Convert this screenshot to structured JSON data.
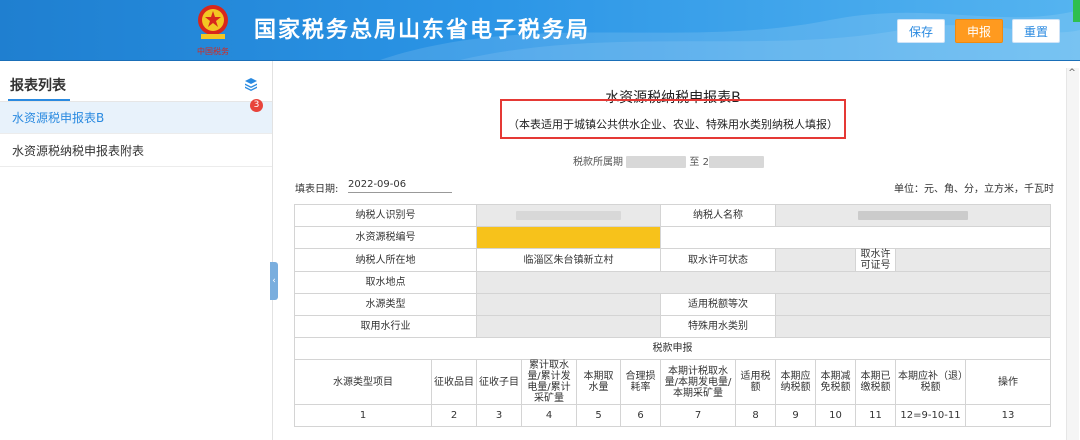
{
  "header": {
    "site_title": "国家税务总局山东省电子税务局",
    "logo_text": "中国税务",
    "buttons": {
      "save": "保存",
      "submit": "申报",
      "reset": "重置"
    }
  },
  "sidebar": {
    "title": "报表列表",
    "items": [
      {
        "label": "水资源税申报表B",
        "badge": "3",
        "active": true
      },
      {
        "label": "水资源税纳税申报表附表",
        "active": false
      }
    ]
  },
  "form": {
    "title": "水资源税纳税申报表B",
    "subtitle": "（本表适用于城镇公共供水企业、农业、特殊用水类别纳税人填报）",
    "period_label": "税款所属期",
    "period_to": "至",
    "period_to_prefix": "2",
    "fill_date_label": "填表日期:",
    "fill_date": "2022-09-06",
    "unit": "单位：元、角、分，立方米，千瓦时",
    "fields": {
      "taxpayer_id": "纳税人识别号",
      "taxpayer_name": "纳税人名称",
      "tax_code": "水资源税编号",
      "location": "纳税人所在地",
      "location_value": "临淄区朱台镇新立村",
      "permit_status": "取水许可状态",
      "permit_no": "取水许可证号",
      "intake_site": "取水地点",
      "source_type": "水源类型",
      "tax_level": "适用税额等次",
      "industry": "取用水行业",
      "special_category": "特殊用水类别",
      "tax_declaration": "税款申报"
    },
    "columns": [
      "水源类型项目",
      "征收品目",
      "征收子目",
      "累计取水量/累计发电量/累计采矿量",
      "本期取水量",
      "合理损耗率",
      "本期计税取水量/本期发电量/本期采矿量",
      "适用税额",
      "本期应纳税额",
      "本期减免税额",
      "本期已缴税额",
      "本期应补（退）税额",
      "操作"
    ],
    "column_numbers": [
      "1",
      "2",
      "3",
      "4",
      "5",
      "6",
      "7",
      "8",
      "9",
      "10",
      "11",
      "12=9-10-11",
      "13"
    ]
  },
  "colors": {
    "header_blue": "#2b95e6",
    "accent": "#2a8ae0",
    "submit_orange": "#ff9a1f",
    "highlight_red": "#e53935",
    "tax_code_yellow": "#f7c21b"
  }
}
